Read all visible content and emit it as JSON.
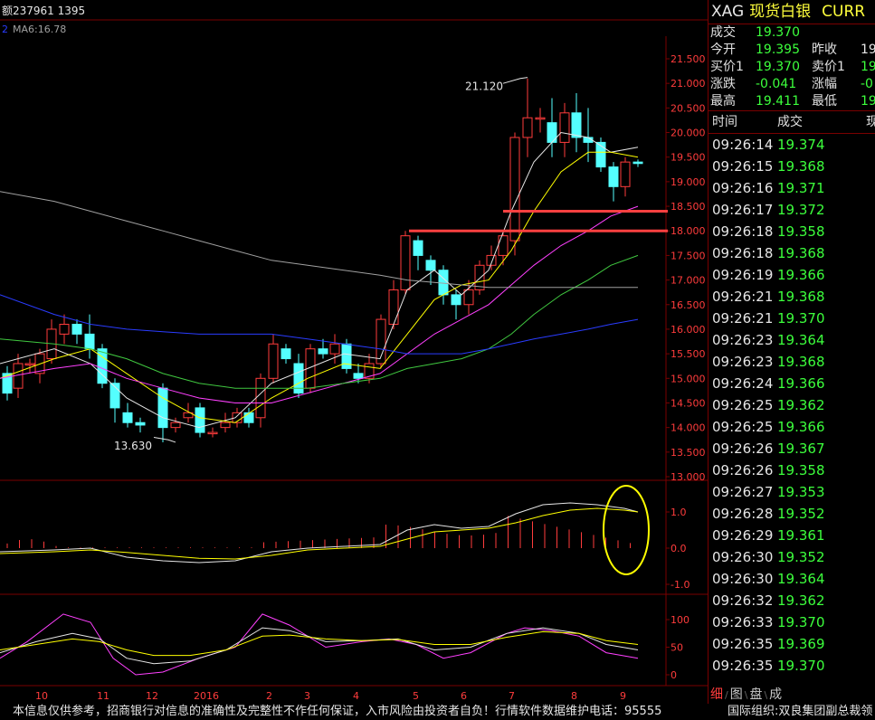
{
  "chart": {
    "info_volume": "额237961 1395",
    "info_ma_num": "2",
    "info_ma": "MA6:16.78",
    "price_axis": [
      "21.500",
      "21.000",
      "20.500",
      "20.000",
      "19.500",
      "19.000",
      "18.500",
      "18.000",
      "17.500",
      "17.000",
      "16.500",
      "16.000",
      "15.500",
      "15.000",
      "14.500",
      "14.000",
      "13.500",
      "13.000"
    ],
    "macd_axis": [
      "1.0",
      "0.0",
      "-1.0"
    ],
    "kdj_axis": [
      "100",
      "50",
      "0"
    ],
    "x_axis": [
      "10",
      "11",
      "12",
      "2016",
      "2",
      "3",
      "4",
      "5",
      "6",
      "7",
      "8",
      "9"
    ],
    "high_label": "21.120",
    "low_label": "13.630",
    "colors": {
      "up": "#ff3c3c",
      "down": "#54ffff",
      "axis": "#7a0000",
      "grid": "#3a0000",
      "ma_white": "#e6e6e6",
      "ma_yellow": "#ffff00",
      "ma_magenta": "#ff40ff",
      "ma_green": "#40c840",
      "ma_blue": "#2a3cff",
      "ma_gray": "#a0a0a0",
      "circle": "#ffff00",
      "hline": "#ff4040"
    }
  },
  "chart_data": {
    "type": "candlestick",
    "x_labels": [
      "10",
      "11",
      "12",
      "2016",
      "2",
      "3",
      "4",
      "5",
      "6",
      "7",
      "8",
      "9"
    ],
    "ylim": [
      13.0,
      21.5
    ],
    "high": 21.12,
    "low": 13.63,
    "horizontal_levels": [
      18.4,
      18.0
    ],
    "ma_current": {
      "MA6": 16.78
    }
  },
  "quote": {
    "code": "XAG",
    "name": "现货白银",
    "curr": "CURR",
    "trade_label": "成交",
    "trade_value": "19.370",
    "open_label": "今开",
    "open_value": "19.395",
    "prevclose_label": "昨收",
    "prevclose_value": "19",
    "bid_label": "买价1",
    "bid_value": "19.370",
    "ask_label": "卖价1",
    "ask_value": "19",
    "change_label": "涨跌",
    "change_value": "-0.041",
    "pct_label": "涨幅",
    "pct_value": "-0",
    "high_label": "最高",
    "high_value": "19.411",
    "low_label": "最低",
    "low_value": "19"
  },
  "ticks": {
    "head_time": "时间",
    "head_price": "成交",
    "head_vol": "现",
    "rows": [
      {
        "time": "09:26:14",
        "price": "19.374"
      },
      {
        "time": "09:26:15",
        "price": "19.368"
      },
      {
        "time": "09:26:16",
        "price": "19.371"
      },
      {
        "time": "09:26:17",
        "price": "19.372"
      },
      {
        "time": "09:26:18",
        "price": "19.358"
      },
      {
        "time": "09:26:18",
        "price": "19.368"
      },
      {
        "time": "09:26:19",
        "price": "19.366"
      },
      {
        "time": "09:26:21",
        "price": "19.368"
      },
      {
        "time": "09:26:21",
        "price": "19.370"
      },
      {
        "time": "09:26:23",
        "price": "19.364"
      },
      {
        "time": "09:26:23",
        "price": "19.368"
      },
      {
        "time": "09:26:24",
        "price": "19.366"
      },
      {
        "time": "09:26:25",
        "price": "19.362"
      },
      {
        "time": "09:26:25",
        "price": "19.366"
      },
      {
        "time": "09:26:26",
        "price": "19.367"
      },
      {
        "time": "09:26:26",
        "price": "19.358"
      },
      {
        "time": "09:26:27",
        "price": "19.353"
      },
      {
        "time": "09:26:28",
        "price": "19.352"
      },
      {
        "time": "09:26:29",
        "price": "19.361"
      },
      {
        "time": "09:26:30",
        "price": "19.352"
      },
      {
        "time": "09:26:30",
        "price": "19.364"
      },
      {
        "time": "09:26:32",
        "price": "19.362"
      },
      {
        "time": "09:26:33",
        "price": "19.370"
      },
      {
        "time": "09:26:35",
        "price": "19.369"
      },
      {
        "time": "09:26:35",
        "price": "19.370"
      }
    ]
  },
  "side_tabs": [
    "细",
    "图",
    "盘",
    "成"
  ],
  "footer": {
    "disclaimer": "本信息仅供参考，招商银行对信息的准确性及完整性不作任何保证，入市风险由投资者自负！行情软件数据维护电话：95555",
    "org": "国际组织:双良集团副总裁领"
  }
}
